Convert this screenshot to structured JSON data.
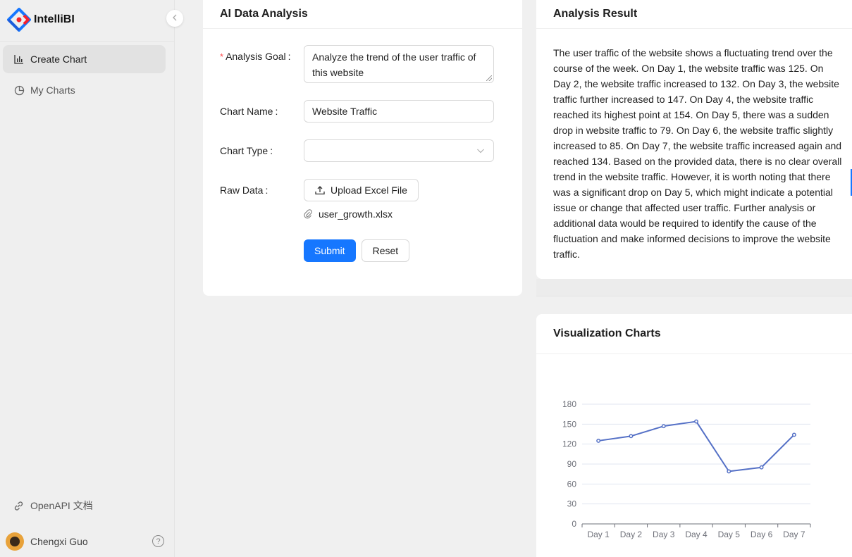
{
  "app": {
    "name": "IntelliBI",
    "brand_color": "#1677ff"
  },
  "sidebar": {
    "items": [
      {
        "label": "Create Chart",
        "icon": "bar-chart-icon",
        "active": true
      },
      {
        "label": "My Charts",
        "icon": "pie-chart-icon",
        "active": false
      }
    ],
    "footer_link": "OpenAPI 文档",
    "user": {
      "name": "Chengxi Guo"
    }
  },
  "form": {
    "title": "AI Data Analysis",
    "goal_label": "Analysis Goal",
    "goal_value": "Analyze the trend of the user traffic of this website",
    "name_label": "Chart Name",
    "name_value": "Website Traffic",
    "type_label": "Chart Type",
    "type_value": "",
    "data_label": "Raw Data",
    "upload_label": "Upload Excel File",
    "file_name": "user_growth.xlsx",
    "submit_label": "Submit",
    "reset_label": "Reset",
    "label_colon": ":"
  },
  "result": {
    "title": "Analysis Result",
    "text": "The user traffic of the website shows a fluctuating trend over the course of the week. On Day 1, the website traffic was 125. On Day 2, the website traffic increased to 132. On Day 3, the website traffic further increased to 147. On Day 4, the website traffic reached its highest point at 154. On Day 5, there was a sudden drop in website traffic to 79. On Day 6, the website traffic slightly increased to 85. On Day 7, the website traffic increased again and reached 134. Based on the provided data, there is no clear overall trend in the website traffic. However, it is worth noting that there was a significant drop on Day 5, which might indicate a potential issue or change that affected user traffic. Further analysis or additional data would be required to identify the cause of the fluctuation and make informed decisions to improve the website traffic."
  },
  "visualization": {
    "title": "Visualization Charts"
  },
  "chart_data": {
    "type": "line",
    "categories": [
      "Day 1",
      "Day 2",
      "Day 3",
      "Day 4",
      "Day 5",
      "Day 6",
      "Day 7"
    ],
    "series": [
      {
        "values": [
          125,
          132,
          147,
          154,
          79,
          85,
          134
        ],
        "color": "#5470c6"
      }
    ],
    "yticks": [
      0,
      30,
      60,
      90,
      120,
      150,
      180
    ],
    "ylim": [
      0,
      180
    ],
    "grid": true,
    "title": "",
    "xlabel": "",
    "ylabel": ""
  }
}
